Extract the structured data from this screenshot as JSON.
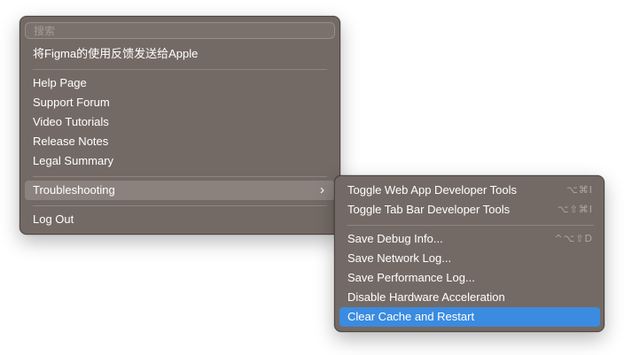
{
  "main_menu": {
    "search_placeholder": "搜索",
    "feedback": "将Figma的使用反馈发送给Apple",
    "help_page": "Help Page",
    "support_forum": "Support Forum",
    "video_tutorials": "Video Tutorials",
    "release_notes": "Release Notes",
    "legal_summary": "Legal Summary",
    "troubleshooting": "Troubleshooting",
    "troubleshooting_chevron": "›",
    "log_out": "Log Out"
  },
  "submenu": {
    "items": [
      {
        "label": "Toggle Web App Developer Tools",
        "shortcut": "⌥⌘I"
      },
      {
        "label": "Toggle Tab Bar Developer Tools",
        "shortcut": "⌥⇧⌘I"
      },
      {
        "label": "Save Debug Info...",
        "shortcut": "^⌥⇧D"
      },
      {
        "label": "Save Network Log...",
        "shortcut": ""
      },
      {
        "label": "Save Performance Log...",
        "shortcut": ""
      },
      {
        "label": "Disable Hardware Acceleration",
        "shortcut": ""
      },
      {
        "label": "Clear Cache and Restart",
        "shortcut": ""
      }
    ]
  },
  "colors": {
    "menu_background": "#746a65",
    "hover_background": "#8b827e",
    "selected_background": "#3b8be0",
    "text": "#ffffff",
    "shortcut_text": "#b2a8a3"
  }
}
